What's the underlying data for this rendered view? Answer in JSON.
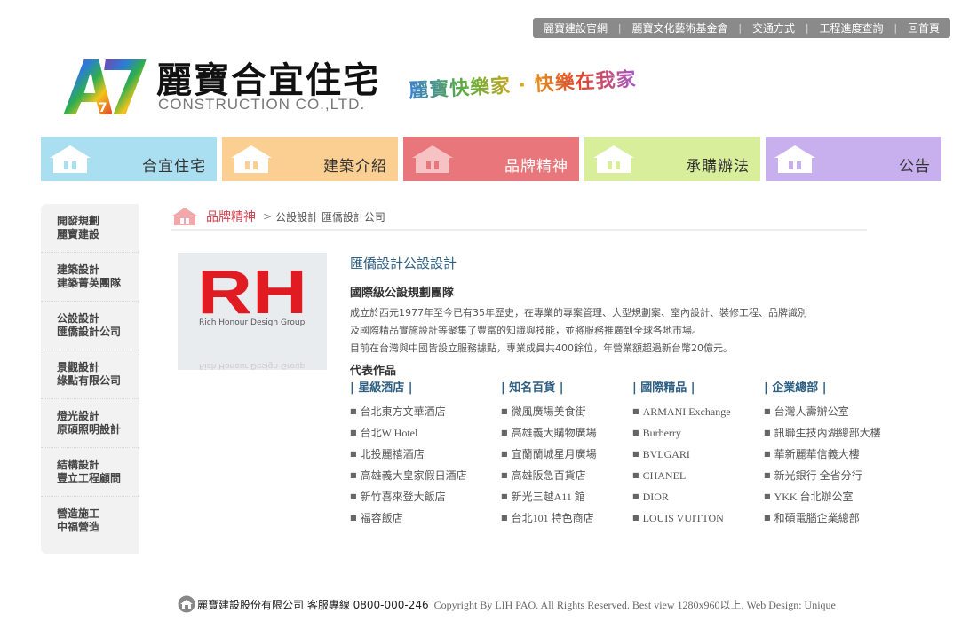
{
  "top_links": [
    {
      "label": "麗寶建設官網"
    },
    {
      "label": "麗寶文化藝術基金會"
    },
    {
      "label": "交通方式"
    },
    {
      "label": "工程進度查詢"
    },
    {
      "label": "回首頁"
    }
  ],
  "logo": {
    "mark_text": "A7",
    "title": "麗寶合宜住宅",
    "subtitle": "CONSTRUCTION CO.,LTD.",
    "slogan": "麗寶快樂家 · 快樂在我家"
  },
  "nav": [
    {
      "label": "合宜住宅",
      "color": "#a9dff0"
    },
    {
      "label": "建築介紹",
      "color": "#fbcf91"
    },
    {
      "label": "品牌精神",
      "color": "#e9767b"
    },
    {
      "label": "承購辦法",
      "color": "#d8ee9b"
    },
    {
      "label": "公告",
      "color": "#c8b0ee"
    }
  ],
  "sidebar": [
    {
      "line1": "開發規劃",
      "line2": "麗寶建設"
    },
    {
      "line1": "建築設計",
      "line2": "建築菁英團隊"
    },
    {
      "line1": "公設設計",
      "line2": "匯僑設計公司"
    },
    {
      "line1": "景觀設計",
      "line2": "綠點有限公司"
    },
    {
      "line1": "燈光設計",
      "line2": "原碩照明設計"
    },
    {
      "line1": "結構設計",
      "line2": "豐立工程顧問"
    },
    {
      "line1": "營造施工",
      "line2": "中福營造"
    }
  ],
  "breadcrumb": {
    "section": "品牌精神",
    "arrow": ">",
    "path": "公設設計 匯僑設計公司"
  },
  "logo_image": {
    "letters": "RH",
    "caption": "Rich Honour Design Group"
  },
  "content": {
    "title": "匯僑設計公設設計",
    "subtitle": "國際級公設規劃團隊",
    "paragraphs": [
      "成立於西元1977年至今已有35年歷史，在專業的專案管理、大型規劃案、室內設計、裝修工程、品牌識別",
      "及國際精品實施設計等聚集了豐富的知識與技能，並將服務推廣到全球各地市場。",
      "目前在台灣與中國皆設立服務據點，專業成員共400餘位，年營業額超過新台幣20億元。"
    ],
    "works_heading": "代表作品",
    "columns": [
      {
        "heading": "| 星級酒店 |",
        "items": [
          "台北東方文華酒店",
          "台北W Hotel",
          "北投麗禧酒店",
          "高雄義大皇家假日酒店",
          "新竹喜來登大飯店",
          "福容飯店"
        ]
      },
      {
        "heading": "| 知名百貨 |",
        "items": [
          "微風廣場美食街",
          "高雄義大購物廣場",
          "宜蘭蘭城星月廣場",
          "高雄阪急百貨店",
          "新光三越A11 館",
          "台北101 特色商店"
        ]
      },
      {
        "heading": "| 國際精品 |",
        "items": [
          "ARMANI Exchange",
          "Burberry",
          "BVLGARI",
          "CHANEL",
          "DIOR",
          "LOUIS VUITTON"
        ]
      },
      {
        "heading": "| 企業總部 |",
        "items": [
          "台灣人壽辦公室",
          "訊聯生技內湖總部大樓",
          "華新麗華信義大樓",
          "新光銀行 全省分行",
          "YKK 台北辦公室",
          "和碩電腦企業總部"
        ]
      }
    ]
  },
  "footer": {
    "company": "麗寶建設股份有限公司 客服專線 0800-000-246",
    "copyright": "Copyright By LIH PAO. All Rights Reserved. Best view 1280x960以上. Web Design: Unique"
  }
}
